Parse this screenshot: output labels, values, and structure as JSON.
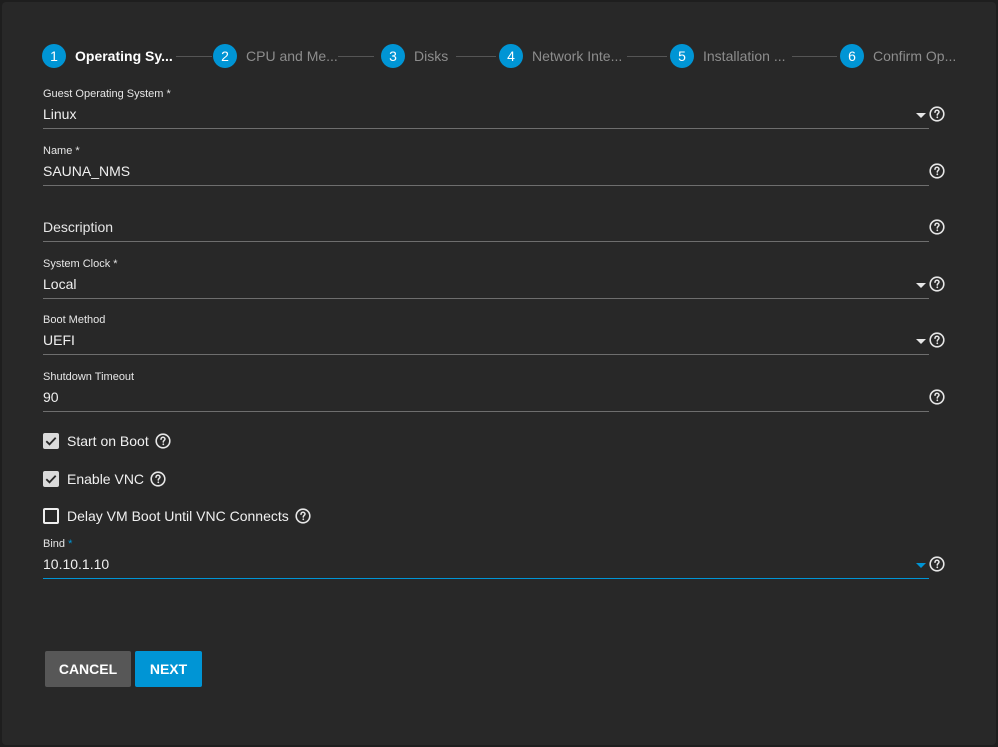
{
  "stepper": {
    "steps": [
      {
        "number": "1",
        "label": "Operating Sy..."
      },
      {
        "number": "2",
        "label": "CPU and Me..."
      },
      {
        "number": "3",
        "label": "Disks"
      },
      {
        "number": "4",
        "label": "Network Inte..."
      },
      {
        "number": "5",
        "label": "Installation ..."
      },
      {
        "number": "6",
        "label": "Confirm Op..."
      }
    ],
    "active_step": "1"
  },
  "form": {
    "guest_os": {
      "label": "Guest Operating System *",
      "value": "Linux"
    },
    "name": {
      "label": "Name *",
      "value": "SAUNA_NMS"
    },
    "description": {
      "placeholder": "Description",
      "value": ""
    },
    "system_clock": {
      "label": "System Clock *",
      "value": "Local"
    },
    "boot_method": {
      "label": "Boot Method",
      "value": "UEFI"
    },
    "shutdown_timeout": {
      "label": "Shutdown Timeout",
      "value": "90"
    },
    "start_on_boot": {
      "label": "Start on Boot",
      "checked": true
    },
    "enable_vnc": {
      "label": "Enable VNC",
      "checked": true
    },
    "delay_vm_boot": {
      "label": "Delay VM Boot Until VNC Connects",
      "checked": false
    },
    "bind": {
      "label": "Bind",
      "required_mark": "*",
      "value": "10.10.1.10"
    }
  },
  "buttons": {
    "cancel": "CANCEL",
    "next": "NEXT"
  },
  "colors": {
    "accent": "#0095d5",
    "background": "#282828",
    "text": "#e6e6e6"
  },
  "icons": {
    "help": "help-circle-icon",
    "dropdown": "chevron-down-icon",
    "check": "check-icon"
  }
}
